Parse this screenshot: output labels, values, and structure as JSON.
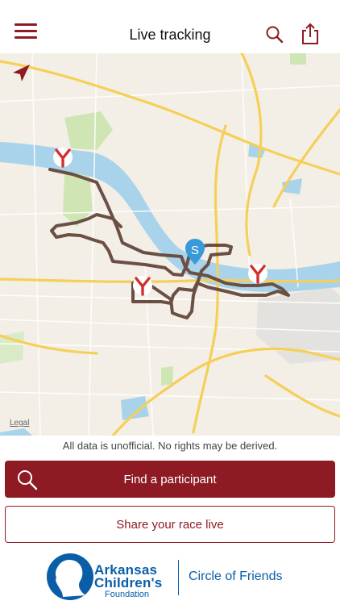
{
  "header": {
    "title": "Live tracking",
    "menu_icon": "hamburger-menu-icon",
    "search_icon": "search-icon",
    "share_icon": "share-icon"
  },
  "map": {
    "legal_label": "Legal",
    "start_marker_label": "S",
    "locate_icon": "location-arrow-icon",
    "marker_icon": "race-logo-y-icon",
    "route_color": "#6b4f45",
    "marker_color": "#d32f2f",
    "start_marker_color": "#3a9ad9",
    "water_color": "#a9d3ea"
  },
  "disclaimer": "All data is unofficial. No rights may be derived.",
  "actions": {
    "find_label": "Find a participant",
    "share_label": "Share your race live",
    "primary_color": "#8e1b23"
  },
  "footer": {
    "org_line1": "Arkansas",
    "org_line2": "Children's",
    "org_line3": "Foundation",
    "partner": "Circle of Friends",
    "brand_color": "#0a5ea8"
  }
}
